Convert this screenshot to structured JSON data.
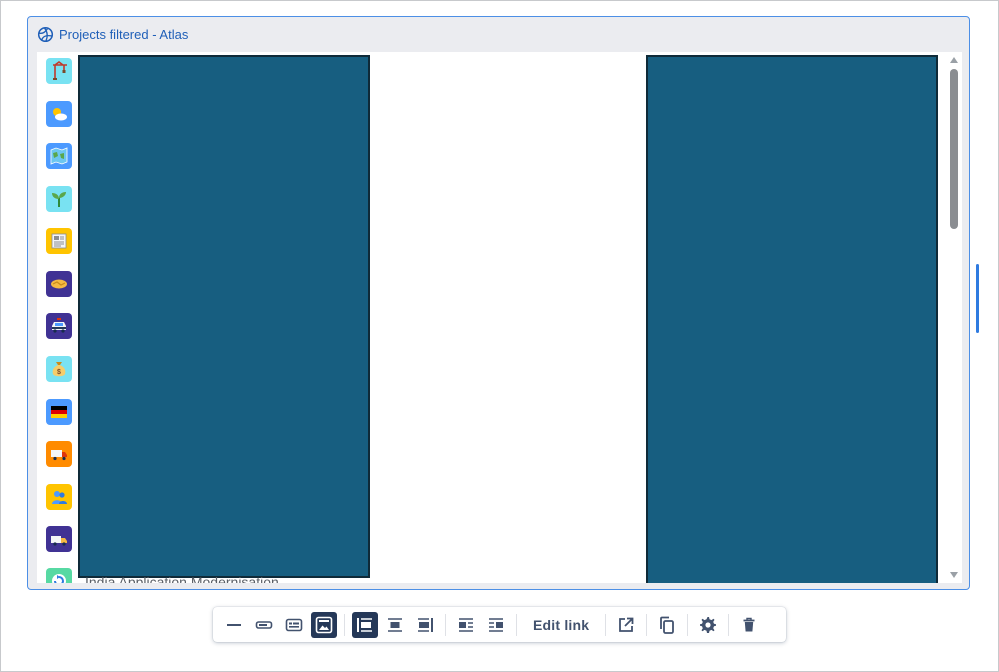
{
  "embed": {
    "title": "Projects filtered - Atlas",
    "cut_off_label": "India Application Modernisation"
  },
  "colors": {
    "panel": "#175e80",
    "accent": "#2f7be0",
    "header_bg": "#ebecf0",
    "toolbar_active": "#253858"
  },
  "sidebar_icons": [
    {
      "name": "construction-crane-icon",
      "bg": "#79e2f2"
    },
    {
      "name": "sun-cloud-icon",
      "bg": "#4c9aff"
    },
    {
      "name": "world-map-icon",
      "bg": "#4c9aff"
    },
    {
      "name": "seedling-icon",
      "bg": "#79e2f2"
    },
    {
      "name": "newspaper-icon",
      "bg": "#ffc400"
    },
    {
      "name": "handshake-icon",
      "bg": "#403294"
    },
    {
      "name": "police-car-icon",
      "bg": "#403294"
    },
    {
      "name": "money-bag-icon",
      "bg": "#79e2f2"
    },
    {
      "name": "germany-flag-icon",
      "bg": "#4c9aff"
    },
    {
      "name": "delivery-truck-icon",
      "bg": "#ff8b00"
    },
    {
      "name": "people-icon",
      "bg": "#ffc400"
    },
    {
      "name": "van-icon",
      "bg": "#403294"
    },
    {
      "name": "refresh-icon",
      "bg": "#57d9a3"
    }
  ],
  "toolbar": {
    "edit_link_label": "Edit link",
    "buttons": [
      "display-url-icon",
      "display-inline-icon",
      "display-card-icon",
      "display-embed-icon",
      "align-left-icon",
      "align-center-icon",
      "align-right-icon",
      "wrap-left-icon",
      "wrap-right-icon",
      "open-new-window-icon",
      "copy-icon",
      "settings-icon",
      "delete-icon"
    ]
  }
}
